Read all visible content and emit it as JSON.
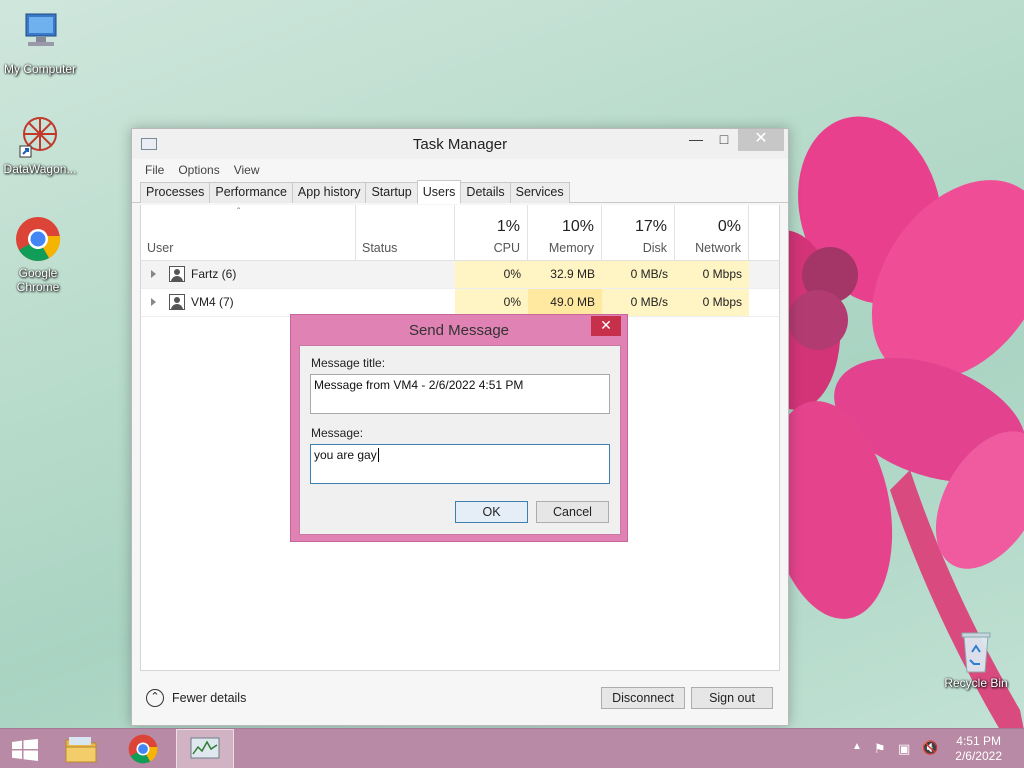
{
  "desktop": {
    "icons": [
      {
        "label": "My Computer"
      },
      {
        "label": "DataWagon..."
      },
      {
        "label": "Google Chrome"
      },
      {
        "label": "Recycle Bin"
      }
    ]
  },
  "task_manager": {
    "title": "Task Manager",
    "menu": [
      "File",
      "Options",
      "View"
    ],
    "tabs": [
      "Processes",
      "Performance",
      "App history",
      "Startup",
      "Users",
      "Details",
      "Services"
    ],
    "active_tab": "Users",
    "columns": {
      "user": "User",
      "status": "Status",
      "cpu": {
        "pct": "1%",
        "name": "CPU"
      },
      "memory": {
        "pct": "10%",
        "name": "Memory"
      },
      "disk": {
        "pct": "17%",
        "name": "Disk"
      },
      "network": {
        "pct": "0%",
        "name": "Network"
      }
    },
    "rows": [
      {
        "user": "Fartz (6)",
        "status": "",
        "cpu": "0%",
        "memory": "32.9 MB",
        "disk": "0 MB/s",
        "network": "0 Mbps"
      },
      {
        "user": "VM4 (7)",
        "status": "",
        "cpu": "0%",
        "memory": "49.0 MB",
        "disk": "0 MB/s",
        "network": "0 Mbps"
      }
    ],
    "footer": {
      "fewer_details": "Fewer details",
      "disconnect": "Disconnect",
      "sign_out": "Sign out"
    }
  },
  "send_message": {
    "title": "Send Message",
    "title_label": "Message title:",
    "title_value": "Message from VM4 - 2/6/2022 4:51 PM",
    "message_label": "Message:",
    "message_value": "you are gay",
    "ok": "OK",
    "cancel": "Cancel"
  },
  "taskbar": {
    "items": [
      "start-button",
      "file-explorer",
      "google-chrome",
      "task-manager"
    ],
    "active_item": "task-manager",
    "time": "4:51 PM",
    "date": "2/6/2022"
  },
  "colors": {
    "dialog_frame": "#e082b4",
    "dialog_close": "#c7304a",
    "taskbar": "#b98aa5",
    "usage_highlight": "#fff4c4"
  }
}
